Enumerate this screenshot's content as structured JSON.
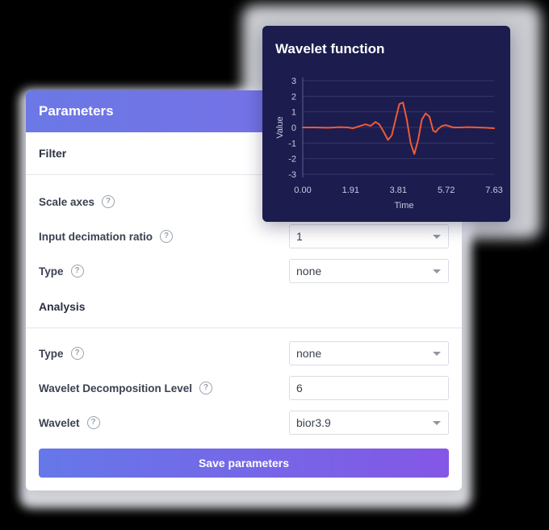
{
  "parameters": {
    "title": "Parameters",
    "filter_section": "Filter",
    "analysis_section": "Analysis",
    "help_glyph": "?",
    "rows": {
      "scale_axes": {
        "label": "Scale axes"
      },
      "input_decimation_ratio": {
        "label": "Input decimation ratio",
        "value": "1"
      },
      "filter_type": {
        "label": "Type",
        "value": "none"
      },
      "analysis_type": {
        "label": "Type",
        "value": "none"
      },
      "decomposition_level": {
        "label": "Wavelet Decomposition Level",
        "value": "6"
      },
      "wavelet": {
        "label": "Wavelet",
        "value": "bior3.9"
      }
    },
    "save_label": "Save parameters"
  },
  "chart_data": {
    "type": "line",
    "title": "Wavelet function",
    "xlabel": "Time",
    "ylabel": "Value",
    "xlim": [
      0,
      7.63
    ],
    "ylim": [
      -3,
      3
    ],
    "x_ticks": [
      "0.00",
      "1.91",
      "3.81",
      "5.72",
      "7.63"
    ],
    "y_ticks": [
      "3",
      "2",
      "1",
      "0",
      "-1",
      "-2",
      "-3"
    ],
    "grid": true,
    "series": [
      {
        "color": "#f05a38",
        "x": [
          0.0,
          0.5,
          1.0,
          1.5,
          1.8,
          2.0,
          2.3,
          2.5,
          2.7,
          2.9,
          3.05,
          3.2,
          3.4,
          3.55,
          3.7,
          3.85,
          4.0,
          4.15,
          4.3,
          4.45,
          4.6,
          4.75,
          4.9,
          5.05,
          5.2,
          5.3,
          5.4,
          5.55,
          5.7,
          5.85,
          6.0,
          6.3,
          6.6,
          7.0,
          7.3,
          7.63
        ],
        "y": [
          0.0,
          0.0,
          -0.02,
          0.02,
          0.0,
          -0.05,
          0.1,
          0.2,
          0.1,
          0.35,
          0.2,
          -0.2,
          -0.8,
          -0.5,
          0.5,
          1.5,
          1.6,
          0.5,
          -1.0,
          -1.7,
          -0.8,
          0.5,
          0.9,
          0.7,
          -0.2,
          -0.3,
          -0.1,
          0.1,
          0.15,
          0.08,
          0.0,
          0.0,
          0.02,
          0.0,
          -0.02,
          -0.05
        ]
      }
    ]
  }
}
